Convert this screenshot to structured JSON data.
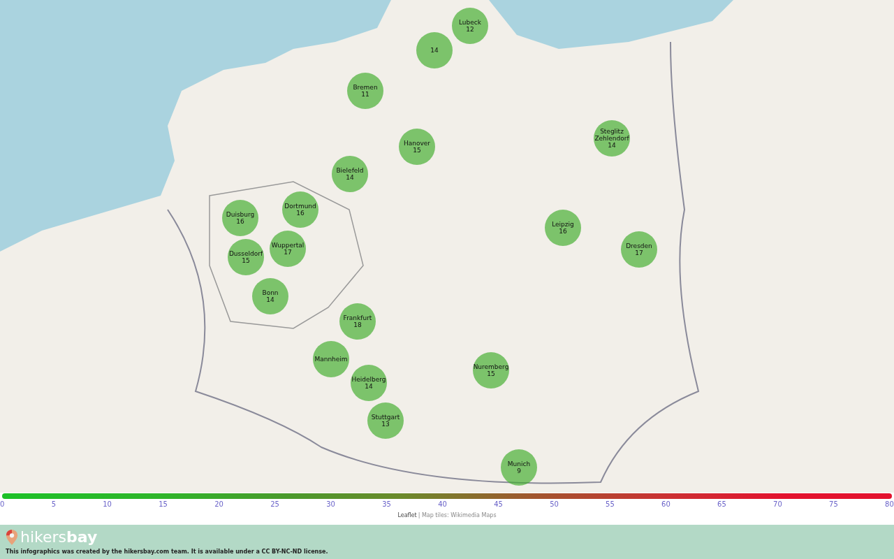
{
  "markers": [
    {
      "name": "Lubeck",
      "value": "12"
    },
    {
      "value": "14"
    },
    {
      "name": "Bremen",
      "value": "11"
    },
    {
      "name": "Hanover",
      "value": "15"
    },
    {
      "name": "Bielefeld",
      "value": "14"
    },
    {
      "name": "Steglitz Zehlendorf",
      "value": "14"
    },
    {
      "name": "Duisburg",
      "value": "16"
    },
    {
      "name": "Dortmund",
      "value": "16"
    },
    {
      "name": "Wuppertal",
      "value": "17"
    },
    {
      "name": "Dusseldorf",
      "value": "15"
    },
    {
      "name": "Bonn",
      "value": "14"
    },
    {
      "name": "Leipzig",
      "value": "16"
    },
    {
      "name": "Dresden",
      "value": "17"
    },
    {
      "name": "Frankfurt",
      "value": "18"
    },
    {
      "name": "Mannheim"
    },
    {
      "name": "Heidelberg",
      "value": "14"
    },
    {
      "name": "Nuremberg",
      "value": "15"
    },
    {
      "name": "Stuttgart",
      "value": "13"
    },
    {
      "name": "Munich",
      "value": "9"
    }
  ],
  "scale": {
    "ticks": [
      "0",
      "5",
      "10",
      "15",
      "20",
      "25",
      "30",
      "35",
      "40",
      "45",
      "50",
      "55",
      "60",
      "65",
      "70",
      "75",
      "80"
    ]
  },
  "attribution": {
    "link": "Leaflet",
    "text": "| Map tiles: Wikimedia Maps"
  },
  "footer": {
    "logo": "hikers**bay**",
    "license": "This infographics was created by the hikersbay.com team. It is available under a CC BY-NC-ND license."
  }
}
